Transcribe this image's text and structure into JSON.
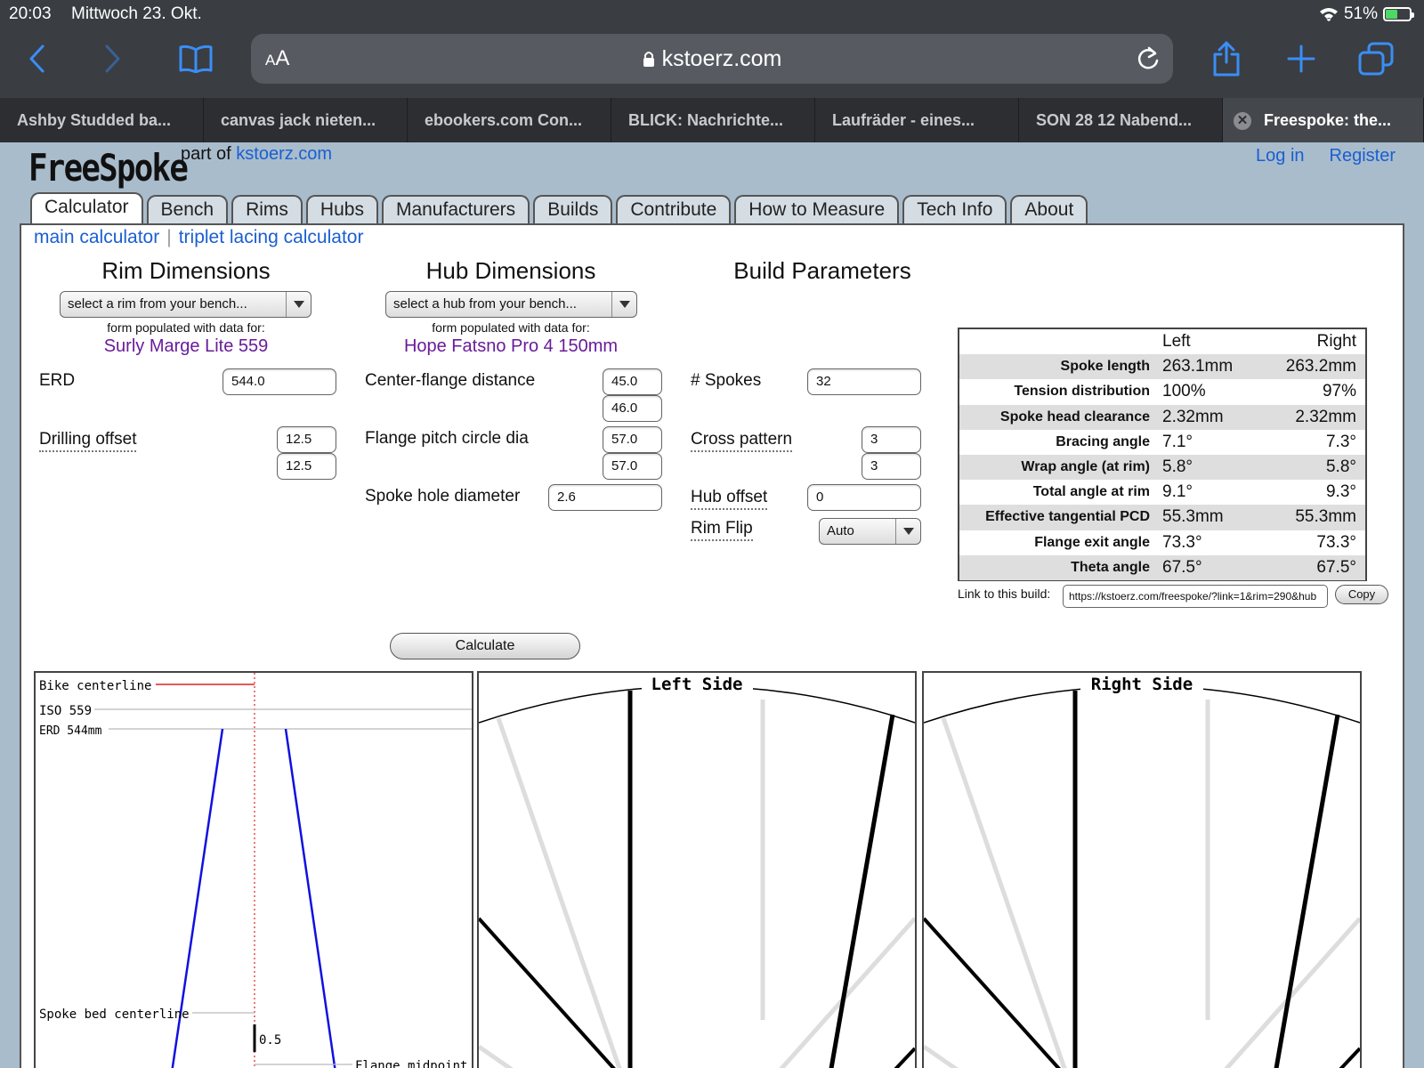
{
  "status": {
    "time": "20:03",
    "date": "Mittwoch 23. Okt.",
    "battery": "51%"
  },
  "browser": {
    "aa_label": "AA",
    "domain": "kstoerz.com",
    "tabs": [
      "Ashby Studded ba...",
      "canvas jack nieten...",
      "ebookers.com Con...",
      "BLICK: Nachrichte...",
      "Laufräder - eines...",
      "SON 28 12 Nabend...",
      "Freespoke: the..."
    ]
  },
  "site": {
    "logo": "FreeSpoke",
    "part_of": "part of",
    "part_of_link": "kstoerz.com",
    "login": "Log in",
    "register": "Register",
    "nav": [
      "Calculator",
      "Bench",
      "Rims",
      "Hubs",
      "Manufacturers",
      "Builds",
      "Contribute",
      "How to Measure",
      "Tech Info",
      "About"
    ],
    "sublinks": {
      "main": "main calculator",
      "sep": "|",
      "triplet": "triplet lacing calculator"
    }
  },
  "rim": {
    "heading": "Rim Dimensions",
    "select": "select a rim from your bench...",
    "note": "form populated with data for:",
    "name": "Surly Marge Lite 559",
    "erd_label": "ERD",
    "erd": "544.0",
    "drill_label": "Drilling offset",
    "drill_left": "12.5",
    "drill_right": "12.5"
  },
  "hub": {
    "heading": "Hub Dimensions",
    "select": "select a hub from your bench...",
    "note": "form populated with data for:",
    "name": "Hope Fatsno Pro 4 150mm",
    "cfd_label": "Center-flange distance",
    "cfd_left": "45.0",
    "cfd_right": "46.0",
    "pcd_label": "Flange pitch circle dia",
    "pcd_left": "57.0",
    "pcd_right": "57.0",
    "shd_label": "Spoke hole diameter",
    "shd": "2.6"
  },
  "build": {
    "heading": "Build Parameters",
    "spokes_label": "# Spokes",
    "spokes": "32",
    "cross_label": "Cross pattern",
    "cross_left": "3",
    "cross_right": "3",
    "offset_label": "Hub offset",
    "offset": "0",
    "flip_label": "Rim Flip",
    "flip": "Auto",
    "calculate": "Calculate"
  },
  "results": {
    "col_left": "Left",
    "col_right": "Right",
    "rows": [
      {
        "label": "Spoke length",
        "left": "263.1mm",
        "right": "263.2mm"
      },
      {
        "label": "Tension distribution",
        "left": "100%",
        "right": "97%"
      },
      {
        "label": "Spoke head clearance",
        "left": "2.32mm",
        "right": "2.32mm"
      },
      {
        "label": "Bracing angle",
        "left": "7.1°",
        "right": "7.3°"
      },
      {
        "label": "Wrap angle (at rim)",
        "left": "5.8°",
        "right": "5.8°"
      },
      {
        "label": "Total angle at rim",
        "left": "9.1°",
        "right": "9.3°"
      },
      {
        "label": "Effective tangential PCD",
        "left": "55.3mm",
        "right": "55.3mm"
      },
      {
        "label": "Flange exit angle",
        "left": "73.3°",
        "right": "73.3°"
      },
      {
        "label": "Theta angle",
        "left": "67.5°",
        "right": "67.5°"
      }
    ],
    "link_label": "Link to this build:",
    "link": "https://kstoerz.com/freespoke/?link=1&rim=290&hub",
    "copy": "Copy"
  },
  "diagrams": {
    "bike_centerline": "Bike centerline",
    "iso": "ISO 559",
    "erd": "ERD 544mm",
    "spoke_bed": "Spoke bed centerline",
    "offset_val": "0.5",
    "flange_mid": "Flange midpoint",
    "left_title": "Left Side",
    "right_title": "Right Side"
  },
  "colors": {
    "link": "#1a5fd0",
    "rim_hub_name": "#6a1b9a",
    "centerline": "#e02020",
    "spoke_profile": "#1010e0"
  }
}
